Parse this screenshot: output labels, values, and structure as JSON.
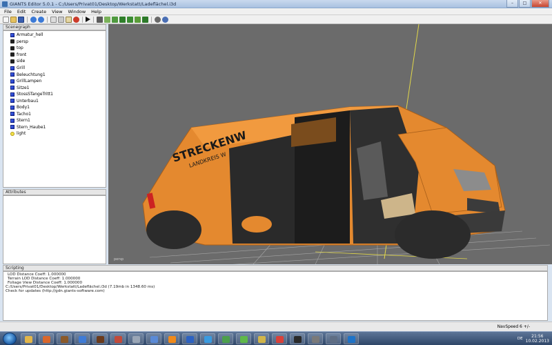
{
  "window": {
    "title": "GIANTS Editor 5.0.1 - C:/Users/Privat01/Desktop/Werkstatt/Ladeflächel.i3d",
    "controls": {
      "minimize": "–",
      "maximize": "□",
      "close": "✕"
    }
  },
  "menu": [
    "File",
    "Edit",
    "Create",
    "View",
    "Window",
    "Help"
  ],
  "toolbar": {
    "icons": [
      "new-icon",
      "open-icon",
      "save-icon",
      "undo-icon",
      "redo-icon",
      "copy-icon",
      "cut-icon",
      "paste-icon",
      "delete-icon",
      "play-icon",
      "select-icon",
      "move-icon",
      "rotate-icon",
      "scale-icon",
      "terrain-sculpt-icon",
      "terrain-paint-icon",
      "foliage-paint-icon",
      "settings-icon",
      "reload-icon"
    ]
  },
  "scenegraph": {
    "title": "Scenegraph",
    "nodes": [
      {
        "label": "Armatur_hell",
        "type": "shape"
      },
      {
        "label": "persp",
        "type": "camera"
      },
      {
        "label": "top",
        "type": "camera"
      },
      {
        "label": "front",
        "type": "camera"
      },
      {
        "label": "side",
        "type": "camera"
      },
      {
        "label": "Grill",
        "type": "shape"
      },
      {
        "label": "Beleuchtung1",
        "type": "shape"
      },
      {
        "label": "GrillLampen",
        "type": "shape"
      },
      {
        "label": "Sitze1",
        "type": "shape"
      },
      {
        "label": "StossSTangeTritt1",
        "type": "shape"
      },
      {
        "label": "Unterbau1",
        "type": "shape"
      },
      {
        "label": "Body1",
        "type": "shape"
      },
      {
        "label": "Tacho1",
        "type": "shape"
      },
      {
        "label": "Stern1",
        "type": "shape"
      },
      {
        "label": "Stern_Haube1",
        "type": "shape"
      },
      {
        "label": "light",
        "type": "light"
      }
    ]
  },
  "attributes": {
    "title": "Attributes"
  },
  "viewport": {
    "van_text_line1": "STRECKENW",
    "van_text_line2": "LANDKREIS W",
    "camera_label": "persp",
    "colors": {
      "background": "#6b6b6b",
      "van_orange": "#e4892f",
      "grid": "#a8a8a8",
      "axis": "#e2d84a"
    }
  },
  "scripting": {
    "title": "Scripting",
    "lines": [
      "LOD Distance Coeff: 1.000000",
      "Terrain LOD Distance Coeff: 1.000000",
      "Foliage View Distance Coeff: 1.000000",
      "C:/Users/Privat01/Desktop/Werkstatt/Ladeflächel.i3d (7.19mb in 1348.60 ms)",
      "Check for updates (http://gdn.giants-software.com)"
    ]
  },
  "status": {
    "navspeed": "NavSpeed 6 +/-"
  },
  "taskbar": {
    "language": "DE",
    "time": "21:56",
    "date": "10.02.2013",
    "apps": [
      {
        "name": "explorer-icon",
        "color": "#e3b64a"
      },
      {
        "name": "firefox-icon",
        "color": "#d9672c"
      },
      {
        "name": "game-icon",
        "color": "#8a5a2b"
      },
      {
        "name": "media-player-icon",
        "color": "#3e7bd6"
      },
      {
        "name": "app-icon",
        "color": "#6b3b1c"
      },
      {
        "name": "paint-icon",
        "color": "#c24a3a"
      },
      {
        "name": "calculator-icon",
        "color": "#9aa6b6"
      },
      {
        "name": "network-icon",
        "color": "#5a8ad6"
      },
      {
        "name": "vlc-icon",
        "color": "#f08a1a"
      },
      {
        "name": "word-icon",
        "color": "#2d62c2"
      },
      {
        "name": "ie-icon",
        "color": "#3a9be0"
      },
      {
        "name": "photo-icon",
        "color": "#4c9f4c"
      },
      {
        "name": "icq-icon",
        "color": "#5fb84a"
      },
      {
        "name": "mail-icon",
        "color": "#d1b54a"
      },
      {
        "name": "chrome-icon",
        "color": "#d9413a"
      },
      {
        "name": "giants-icon",
        "color": "#2a2a2a"
      },
      {
        "name": "tool-icon",
        "color": "#7a7a7a"
      },
      {
        "name": "settings-icon",
        "color": "#5f6e84"
      },
      {
        "name": "teamviewer-icon",
        "color": "#1f73c7"
      }
    ]
  }
}
